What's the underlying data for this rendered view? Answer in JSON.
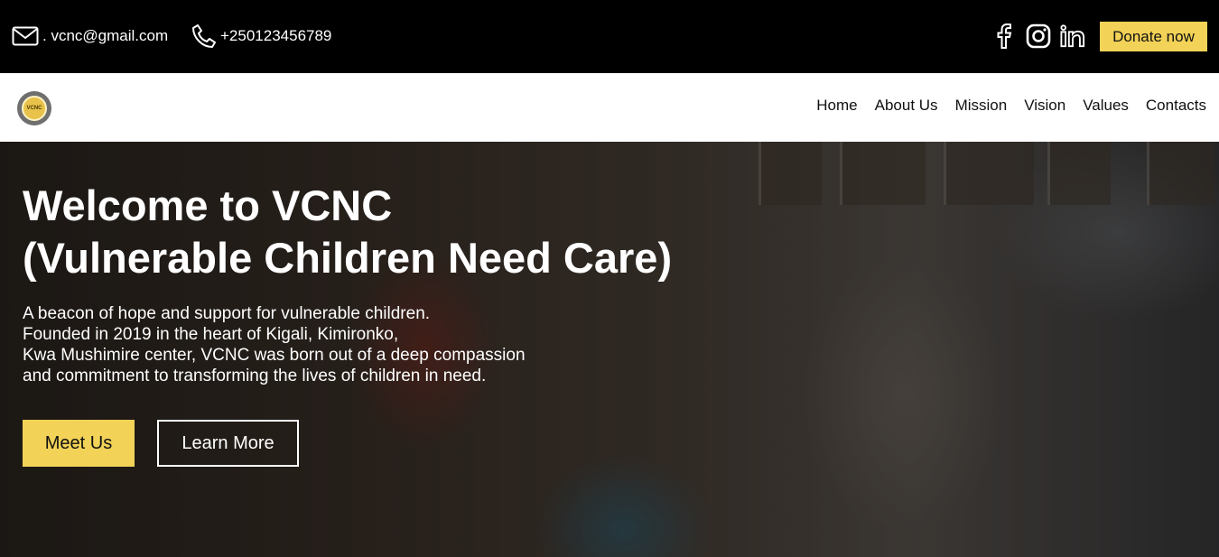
{
  "topbar": {
    "email": ". vcnc@gmail.com",
    "phone": "+250123456789",
    "socials": [
      {
        "icon": "facebook-icon"
      },
      {
        "icon": "instagram-icon"
      },
      {
        "icon": "linkedin-icon"
      }
    ],
    "donate_label": "Donate now"
  },
  "navbar": {
    "logo_text": "VCNC",
    "items": [
      {
        "label": "Home"
      },
      {
        "label": "About Us"
      },
      {
        "label": "Mission"
      },
      {
        "label": "Vision"
      },
      {
        "label": "Values"
      },
      {
        "label": "Contacts"
      }
    ]
  },
  "hero": {
    "title_line1": "Welcome to VCNC",
    "title_line2": "(Vulnerable Children Need Care)",
    "desc_lines": [
      "A beacon of hope and support for vulnerable children.",
      "Founded in 2019 in the heart of Kigali, Kimironko,",
      "Kwa Mushimire center, VCNC was born out of a deep compassion",
      "and commitment to transforming the lives of children in need."
    ],
    "primary_button": "Meet Us",
    "secondary_button": "Learn More"
  },
  "colors": {
    "accent": "#f2d257",
    "topbar_bg": "#000000",
    "nav_bg": "#ffffff"
  }
}
